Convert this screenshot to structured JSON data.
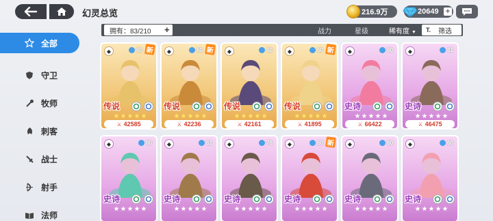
{
  "header": {
    "title": "幻灵总览",
    "gold": "216.9万",
    "gems": "20649",
    "icons": [
      "back-arrow-icon",
      "home-icon",
      "coin-icon",
      "gem-icon",
      "plus-icon",
      "chat-icon"
    ]
  },
  "sidebar": {
    "items": [
      {
        "label": "全部",
        "icon": "star-outline-icon",
        "active": true
      },
      {
        "label": "守卫",
        "icon": "shield-icon"
      },
      {
        "label": "牧师",
        "icon": "staff-icon"
      },
      {
        "label": "刺客",
        "icon": "dagger-icon"
      },
      {
        "label": "战士",
        "icon": "sword-icon"
      },
      {
        "label": "射手",
        "icon": "bow-icon"
      },
      {
        "label": "法师",
        "icon": "book-icon"
      }
    ]
  },
  "filterbar": {
    "owned": "拥有：83/210",
    "tab_power": "战力",
    "tab_star": "星级",
    "tab_rarity": "稀有度",
    "filter_label": "筛选"
  },
  "cards": [
    {
      "rarity": "legend",
      "rarity_label": "传说",
      "level": "60",
      "new": "新",
      "power": "42585",
      "stars": 5,
      "color": "#f0c070"
    },
    {
      "rarity": "legend",
      "rarity_label": "传说",
      "level": "60",
      "new": "新",
      "power": "42236",
      "stars": 5,
      "color": "#f0c070"
    },
    {
      "rarity": "legend",
      "rarity_label": "传说",
      "level": "60",
      "power": "42161",
      "stars": 5,
      "color": "#f0c070"
    },
    {
      "rarity": "legend",
      "rarity_label": "传说",
      "level": "60",
      "new": "新",
      "power": "41895",
      "stars": 5,
      "color": "#f0c070"
    },
    {
      "rarity": "epic",
      "rarity_label": "史诗",
      "level": "60",
      "power": "66422",
      "stars": 5,
      "color": "#e0a0e0"
    },
    {
      "rarity": "epic",
      "rarity_label": "史诗",
      "level": "61",
      "power": "46475",
      "stars": 5,
      "color": "#e0a0e0"
    },
    {
      "rarity": "epic",
      "rarity_label": "史诗",
      "level": "60",
      "stars": 5,
      "color": "#e0a0e0"
    },
    {
      "rarity": "epic",
      "rarity_label": "史诗",
      "level": "61",
      "stars": 5,
      "color": "#e0a0e0"
    },
    {
      "rarity": "epic",
      "rarity_label": "史诗",
      "level": "76",
      "stars": 5,
      "color": "#e0a0e0"
    },
    {
      "rarity": "epic",
      "rarity_label": "史诗",
      "level": "60",
      "new": "新",
      "stars": 5,
      "color": "#e0a0e0"
    },
    {
      "rarity": "epic",
      "rarity_label": "史诗",
      "level": "60",
      "stars": 5,
      "color": "#e0a0e0"
    },
    {
      "rarity": "epic",
      "rarity_label": "史诗",
      "level": "60",
      "stars": 5,
      "color": "#e0a0e0"
    }
  ]
}
